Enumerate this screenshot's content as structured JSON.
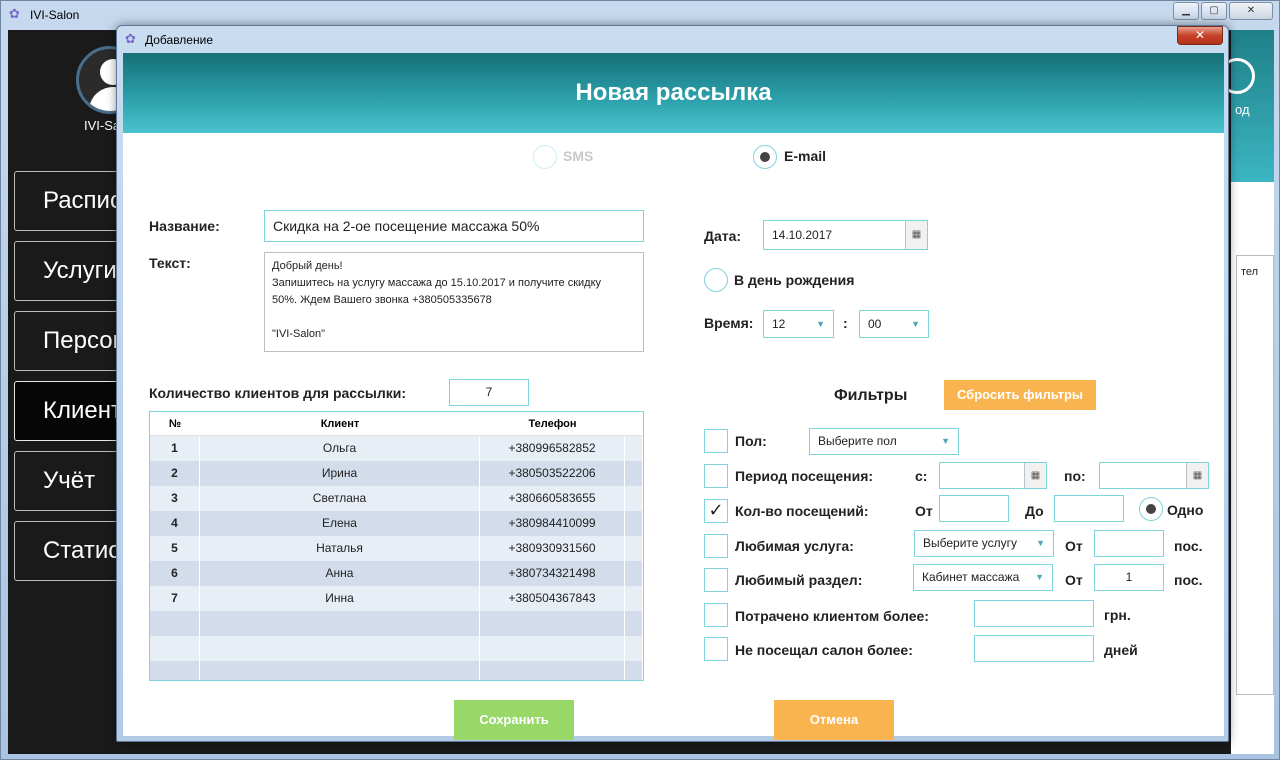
{
  "main": {
    "title": "IVI-Salon",
    "title_icon": "butterfly-logo-icon",
    "close_label": "✕",
    "user_name": "IVI-Salon",
    "exit_label": "од",
    "right_column_fragment": "тел",
    "menu": [
      {
        "label": "Расписание"
      },
      {
        "label": "Услуги"
      },
      {
        "label": "Персонал"
      },
      {
        "label": "Клиенты"
      },
      {
        "label": "Учёт"
      },
      {
        "label": "Статистика"
      }
    ],
    "active_menu_index": 3
  },
  "dialog": {
    "title": "Добавление",
    "close_label": "✕",
    "header": "Новая рассылка",
    "channel": {
      "sms_label": "SMS",
      "email_label": "E-mail",
      "selected": "E-mail"
    },
    "name_label": "Название:",
    "name_value": "Скидка на 2-ое посещение массажа 50%",
    "text_label": "Текст:",
    "text_lines": [
      "Добрый день!",
      "Запишитесь на услугу массажа до 15.10.2017 и получите скидку",
      "50%. Ждем Вашего звонка +380505335678",
      "",
      "\"IVI-Salon\""
    ],
    "date_label": "Дата:",
    "date_value": "14.10.2017",
    "birthday_label": "В день рождения",
    "time_label": "Время:",
    "time_hour": "12",
    "time_sep": ":",
    "time_minute": "00",
    "count_label": "Количество клиентов для рассылки:",
    "count_value": "7",
    "table": {
      "headers": [
        "№",
        "Клиент",
        "Телефон"
      ],
      "rows": [
        [
          "1",
          "Ольга",
          "+380996582852"
        ],
        [
          "2",
          "Ирина",
          "+380503522206"
        ],
        [
          "3",
          "Светлана",
          "+380660583655"
        ],
        [
          "4",
          "Елена",
          "+380984410099"
        ],
        [
          "5",
          "Наталья",
          "+380930931560"
        ],
        [
          "6",
          "Анна",
          "+380734321498"
        ],
        [
          "7",
          "Инна",
          "+380504367843"
        ]
      ]
    },
    "filters": {
      "title": "Фильтры",
      "reset_label": "Сбросить фильтры",
      "gender_label": "Пол:",
      "gender_value": "Выберите пол",
      "period_label": "Период посещения:",
      "period_from_label": "с:",
      "period_to_label": "по:",
      "visits_label": "Кол-во посещений:",
      "visits_checked": true,
      "visits_from_label": "От",
      "visits_to_label": "До",
      "visits_one_label": "Одно",
      "fav_service_label": "Любимая услуга:",
      "fav_service_value": "Выберите услугу",
      "fav_service_from": "От",
      "fav_service_unit": "пос.",
      "fav_section_label": "Любимый раздел:",
      "fav_section_value": "Кабинет массажа",
      "fav_section_from": "От",
      "fav_section_count": "1",
      "fav_section_unit": "пос.",
      "spent_label": "Потрачено клиентом более:",
      "spent_unit": "грн.",
      "absent_label": "Не посещал салон более:",
      "absent_unit": "дней"
    },
    "save_label": "Сохранить",
    "cancel_label": "Отмена"
  }
}
